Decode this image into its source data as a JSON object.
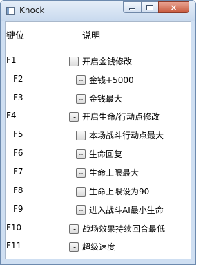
{
  "window": {
    "title": "Knock",
    "controls": {
      "min": "minimize",
      "max": "maximize",
      "close": "×"
    }
  },
  "header": {
    "key_col": "键位",
    "desc_col": "说明"
  },
  "button_glyph": "...",
  "rows": [
    {
      "key": "F1",
      "label": "开启金钱修改"
    },
    {
      "key": "F2",
      "label": "金钱+5000"
    },
    {
      "key": "F3",
      "label": "金钱最大"
    },
    {
      "key": "F4",
      "label": "开启生命/行动点修改"
    },
    {
      "key": "F5",
      "label": "本场战斗行动点最大"
    },
    {
      "key": "F6",
      "label": "生命回复"
    },
    {
      "key": "F7",
      "label": "生命上限最大"
    },
    {
      "key": "F8",
      "label": "生命上限设为90"
    },
    {
      "key": "F9",
      "label": "进入战斗AI最小生命"
    },
    {
      "key": "F10",
      "label": "战场效果持续回合最低"
    },
    {
      "key": "F11",
      "label": "超级速度"
    }
  ]
}
